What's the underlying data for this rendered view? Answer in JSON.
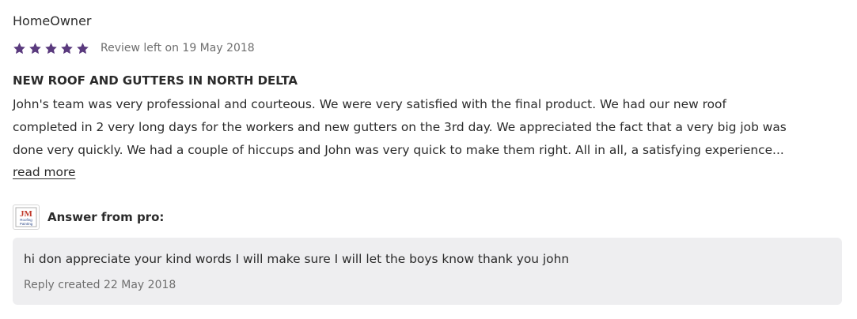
{
  "review": {
    "author": "HomeOwner",
    "rating": 5,
    "rating_max": 5,
    "star_color": "#5a3a7e",
    "date_text": "Review left on 19 May 2018",
    "title": "NEW ROOF AND GUTTERS IN NORTH DELTA",
    "body_lines": [
      "John's team was very professional and courteous. We were very satisfied with the final product. We had our new roof",
      "completed in 2 very long days for the workers and new gutters on the 3rd day. We appreciated the fact that a very big job was",
      "done very quickly. We had a couple of hiccups and John was very quick to make them right. All in all, a satisfying experience..."
    ],
    "read_more_label": "read more"
  },
  "pro_answer": {
    "logo_icon": "company-logo-icon",
    "logo_text": "JM",
    "logo_subtext": [
      "Roofing",
      "Painting"
    ],
    "label": "Answer from pro:",
    "reply_text": "hi don appreciate your kind words I will make sure I will let the boys know thank you john",
    "reply_date_text": "Reply created 22 May 2018",
    "box_color": "#eeeef0"
  }
}
